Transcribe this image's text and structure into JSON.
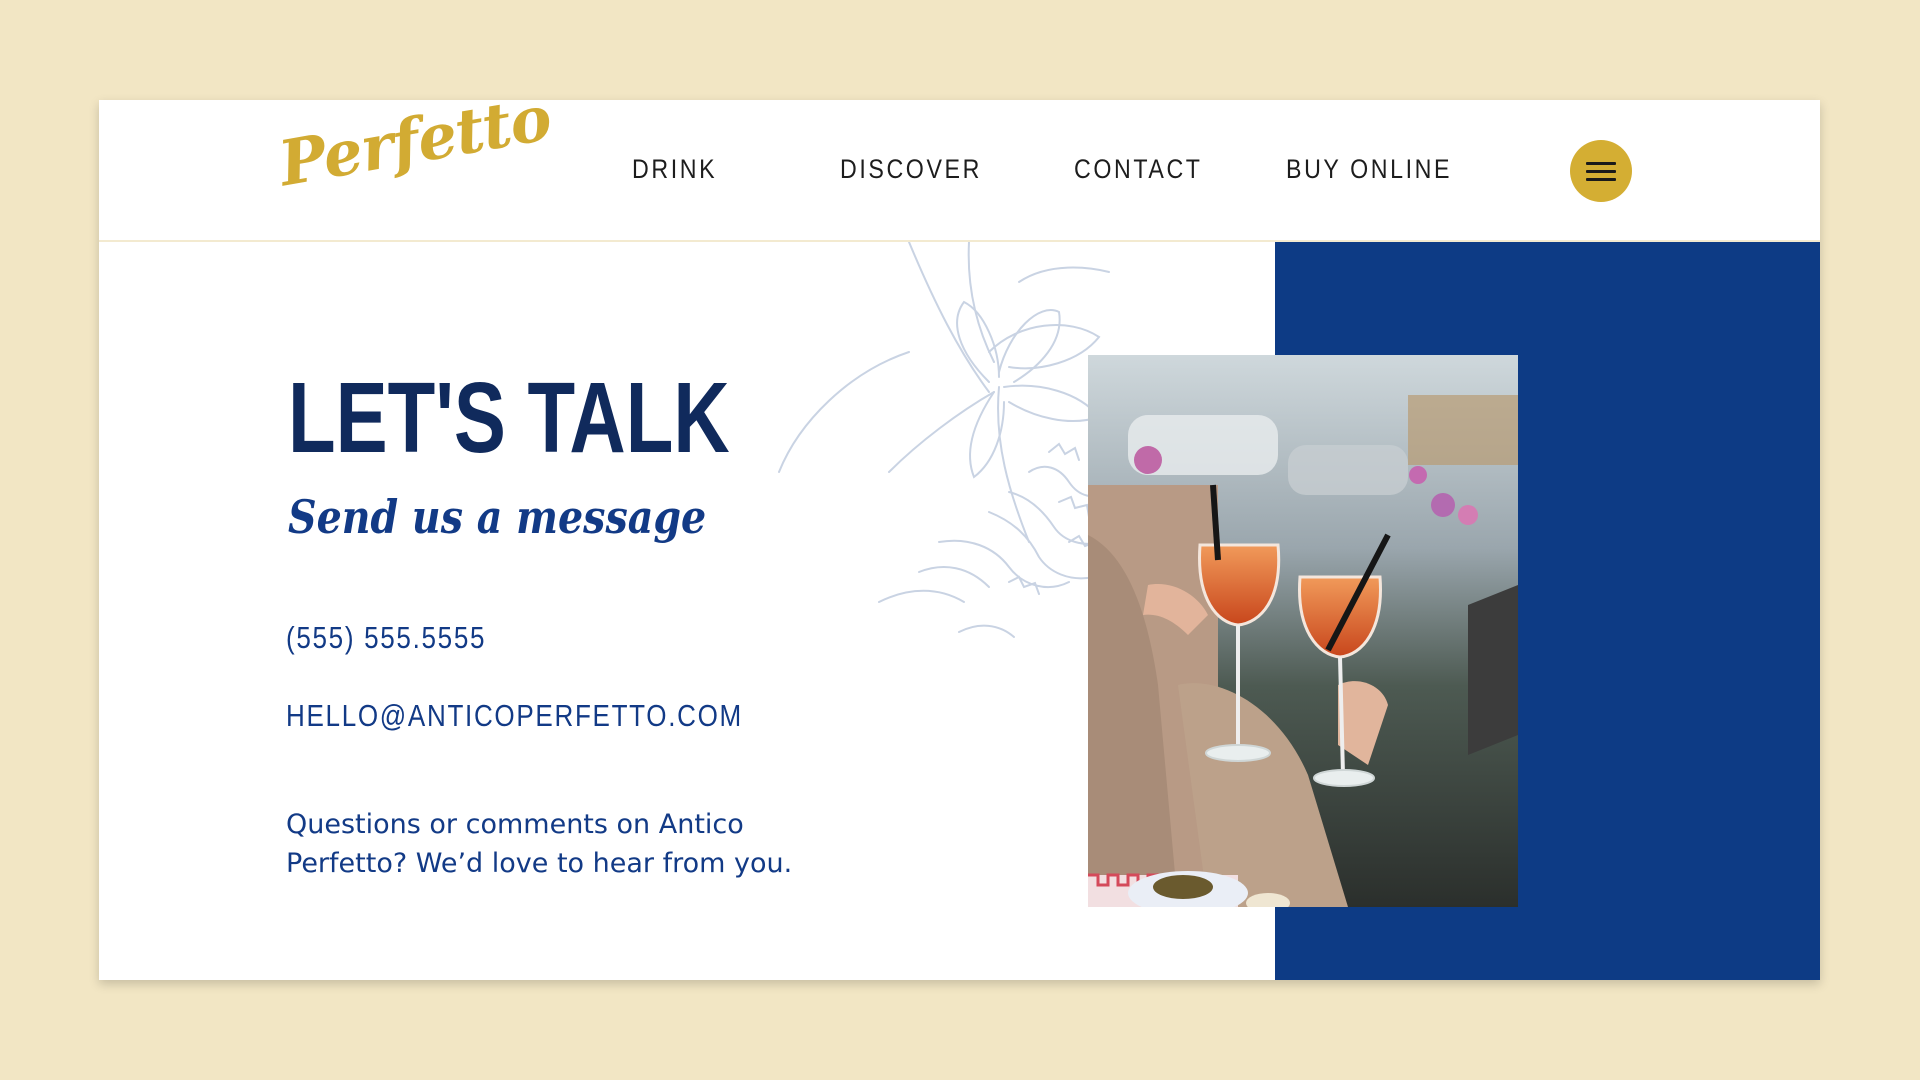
{
  "brand": {
    "name": "Perfetto"
  },
  "nav": {
    "items": [
      {
        "label": "DRINK"
      },
      {
        "label": "DISCOVER"
      },
      {
        "label": "CONTACT"
      },
      {
        "label": "BUY ONLINE"
      }
    ],
    "menu_icon": "hamburger-icon"
  },
  "contact": {
    "heading": "LET'S TALK",
    "subheading": "Send us a message",
    "phone": "(555) 555.5555",
    "email": "HELLO@ANTICOPERFETTO.COM",
    "blurb": "Questions or comments on Antico Perfetto? We’d love to hear from you."
  },
  "colors": {
    "page_background": "#f2e6c4",
    "brand_gold": "#d4ae33",
    "brand_navy": "#102a5c",
    "panel_blue": "#0d3b85"
  }
}
